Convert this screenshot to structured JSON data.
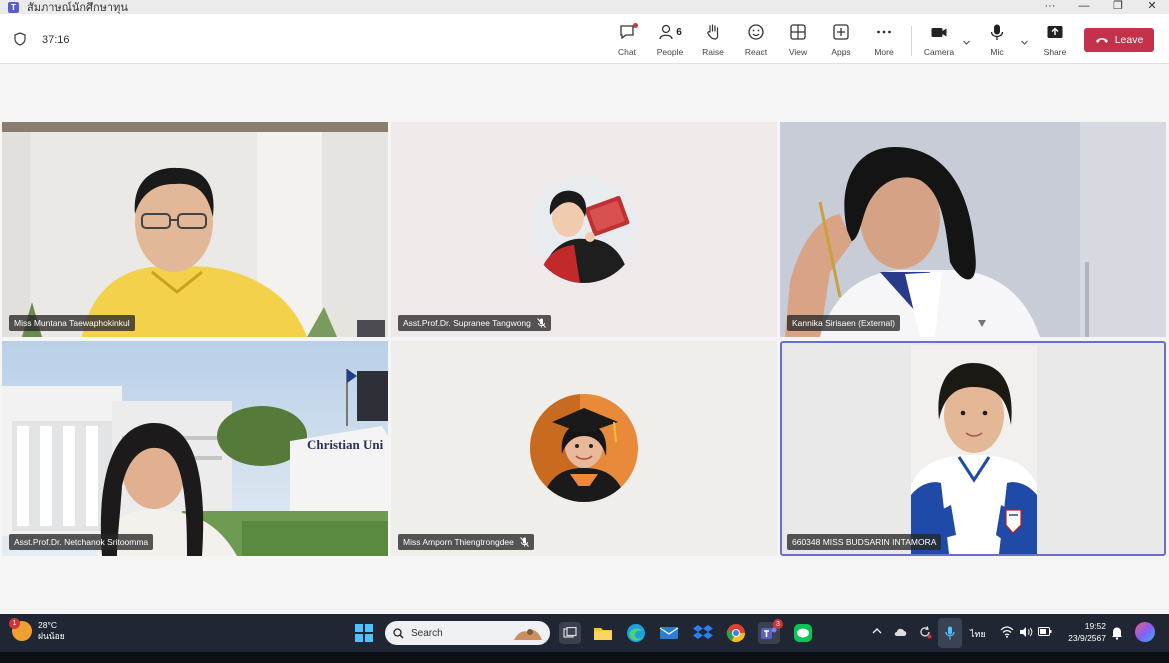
{
  "window": {
    "title": "สัมภาษณ์นักศึกษาทุน",
    "controls": [
      "···",
      "—",
      "❐",
      "✕"
    ]
  },
  "meeting": {
    "timer": "37:16",
    "toolbar": {
      "chat": "Chat",
      "people": "People",
      "people_count": "6",
      "raise": "Raise",
      "react": "React",
      "view": "View",
      "apps": "Apps",
      "more": "More",
      "camera": "Camera",
      "mic": "Mic",
      "share": "Share",
      "leave": "Leave"
    },
    "participants": [
      {
        "name": "Miss Muntana Taewaphokinkul",
        "muted": false
      },
      {
        "name": "Asst.Prof.Dr. Supranee Tangwong",
        "muted": true
      },
      {
        "name": "Kannika Sirisaen (External)",
        "muted": false
      },
      {
        "name": "Asst.Prof.Dr. Netchanok Sritoomma",
        "muted": false
      },
      {
        "name": "Miss Amporn Thiengtrongdee",
        "muted": true
      },
      {
        "name": "660348 MISS BUDSARIN INTAMORA",
        "muted": false
      }
    ],
    "background_sign": "Christian Uni"
  },
  "taskbar": {
    "weather_temp": "28°C",
    "weather_desc": "ฝนน้อย",
    "weather_badge": "1",
    "search_placeholder": "Search",
    "teams_badge": "3",
    "language": "ไทย",
    "time": "19:52",
    "date": "23/9/2567"
  },
  "colors": {
    "leave": "#c4314b",
    "accent": "#5b5fc7",
    "taskbar": "#202633",
    "active_tile_border": "#6b6fc9"
  }
}
